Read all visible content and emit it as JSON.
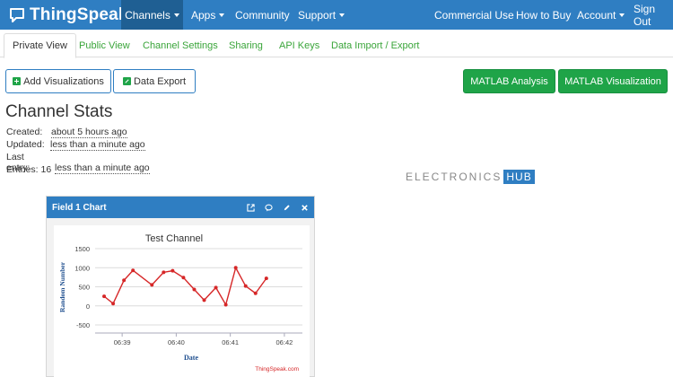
{
  "brand": {
    "name": "ThingSpeak",
    "tm": "™"
  },
  "nav": {
    "channels": "Channels",
    "apps": "Apps",
    "community": "Community",
    "support": "Support",
    "commercial_use": "Commercial Use",
    "how_to_buy": "How to Buy",
    "account": "Account",
    "sign_out": "Sign Out"
  },
  "tabs": [
    "Private View",
    "Public View",
    "Channel Settings",
    "Sharing",
    "API Keys",
    "Data Import / Export"
  ],
  "buttons": {
    "add_visualizations": "Add Visualizations",
    "data_export": "Data Export",
    "matlab_analysis": "MATLAB Analysis",
    "matlab_visualization": "MATLAB Visualization"
  },
  "stats": {
    "title": "Channel Stats",
    "created_label": "Created:",
    "created_value": "about 5 hours ago",
    "updated_label": "Updated:",
    "updated_value": "less than a minute ago",
    "last_entry_label": "Last entry:",
    "last_entry_value": "less than a minute ago",
    "entries_label": "Entries: 16"
  },
  "watermark": {
    "part1": "ELECTRONICS",
    "part2": "HUB"
  },
  "panel": {
    "title": "Field 1 Chart"
  },
  "colors": {
    "nav_blue": "#2f7ec2",
    "nav_active": "#1f5f93",
    "green": "#1fa448",
    "series": "#d62728"
  },
  "chart_data": {
    "type": "line",
    "title": "Test Channel",
    "xlabel": "Date",
    "ylabel": "Random Number",
    "x_ticks": [
      "06:39",
      "06:40",
      "06:41",
      "06:42"
    ],
    "y_ticks": [
      1500,
      1000,
      500,
      0,
      -500
    ],
    "ylim": [
      -500,
      1500
    ],
    "grid": true,
    "credit": "ThingSpeak.com",
    "series": [
      {
        "x": [
          "06:38:40",
          "06:38:50",
          "06:39:02",
          "06:39:12",
          "06:39:33",
          "06:39:46",
          "06:39:56",
          "06:40:08",
          "06:40:20",
          "06:40:31",
          "06:40:44",
          "06:40:55",
          "06:41:06",
          "06:41:17",
          "06:41:28",
          "06:41:40"
        ],
        "values": [
          250,
          60,
          670,
          930,
          550,
          880,
          920,
          740,
          430,
          150,
          480,
          30,
          1000,
          520,
          330,
          720
        ]
      }
    ]
  }
}
